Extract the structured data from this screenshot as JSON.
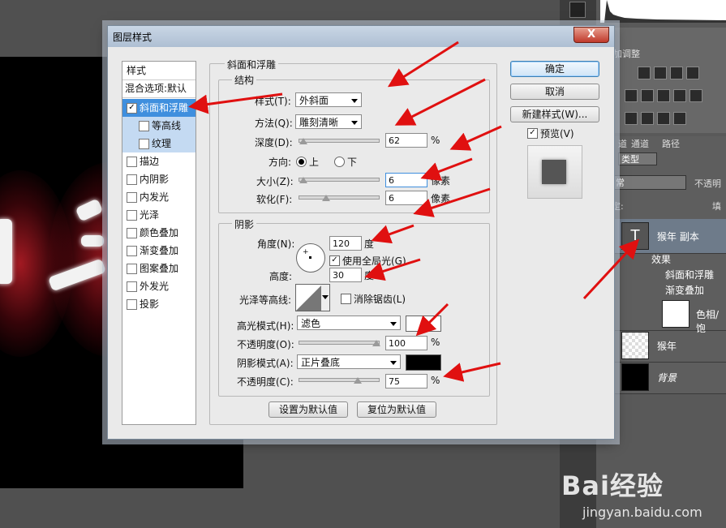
{
  "dialog": {
    "title": "图层样式",
    "close_label": "X",
    "buttons": {
      "ok": "确定",
      "cancel": "取消",
      "new_style": "新建样式(W)...",
      "preview": "预览(V)"
    },
    "style_list": {
      "header": "样式",
      "blend_options": "混合选项:默认",
      "items": [
        {
          "label": "斜面和浮雕",
          "checked": true
        },
        {
          "label": "等高线",
          "checked": false
        },
        {
          "label": "纹理",
          "checked": false
        },
        {
          "label": "描边",
          "checked": false
        },
        {
          "label": "内阴影",
          "checked": false
        },
        {
          "label": "内发光",
          "checked": false
        },
        {
          "label": "光泽",
          "checked": false
        },
        {
          "label": "颜色叠加",
          "checked": false
        },
        {
          "label": "渐变叠加",
          "checked": false
        },
        {
          "label": "图案叠加",
          "checked": false
        },
        {
          "label": "外发光",
          "checked": false
        },
        {
          "label": "投影",
          "checked": false
        }
      ]
    },
    "bevel": {
      "section_title": "斜面和浮雕",
      "structure_title": "结构",
      "style_label": "样式(T):",
      "style_value": "外斜面",
      "technique_label": "方法(Q):",
      "technique_value": "雕刻清晰",
      "depth_label": "深度(D):",
      "depth_value": "62",
      "depth_unit": "%",
      "direction_label": "方向:",
      "direction_up": "上",
      "direction_down": "下",
      "size_label": "大小(Z):",
      "size_value": "6",
      "size_unit": "像素",
      "soften_label": "软化(F):",
      "soften_value": "6",
      "soften_unit": "像素"
    },
    "shading": {
      "title": "阴影",
      "angle_label": "角度(N):",
      "angle_value": "120",
      "angle_unit": "度",
      "global_light_label": "使用全局光(G)",
      "altitude_label": "高度:",
      "altitude_value": "30",
      "altitude_unit": "度",
      "gloss_label": "光泽等高线:",
      "antialias_label": "消除锯齿(L)",
      "highlight_mode_label": "高光模式(H):",
      "highlight_mode_value": "滤色",
      "highlight_opacity_label": "不透明度(O):",
      "highlight_opacity_value": "100",
      "highlight_opacity_unit": "%",
      "shadow_mode_label": "阴影模式(A):",
      "shadow_mode_value": "正片叠底",
      "shadow_opacity_label": "不透明度(C):",
      "shadow_opacity_value": "75",
      "shadow_opacity_unit": "%",
      "highlight_color": "#ffffff",
      "shadow_color": "#000000"
    },
    "footer": {
      "make_default": "设置为默认值",
      "reset_default": "复位为默认值"
    }
  },
  "panels": {
    "adjust_tab": "加调整",
    "tabs": [
      "道",
      "通道",
      "路径"
    ],
    "kind_label": "类型",
    "blend_mode": "常",
    "opacity_label": "不透明",
    "lock_label": "定:",
    "fill_label": "填",
    "layers": [
      {
        "name": "猴年 副本",
        "thumb": "T"
      },
      {
        "name": "效果"
      },
      {
        "name": "斜面和浮雕"
      },
      {
        "name": "渐变叠加"
      },
      {
        "name": "色相/饱"
      },
      {
        "name": "猴年"
      },
      {
        "name": "背景"
      }
    ]
  },
  "watermark": {
    "brand": "Bai经验",
    "url": "jingyan.baidu.com"
  },
  "colors": {
    "accent": "#3f8fde",
    "arrow": "#e01010"
  }
}
